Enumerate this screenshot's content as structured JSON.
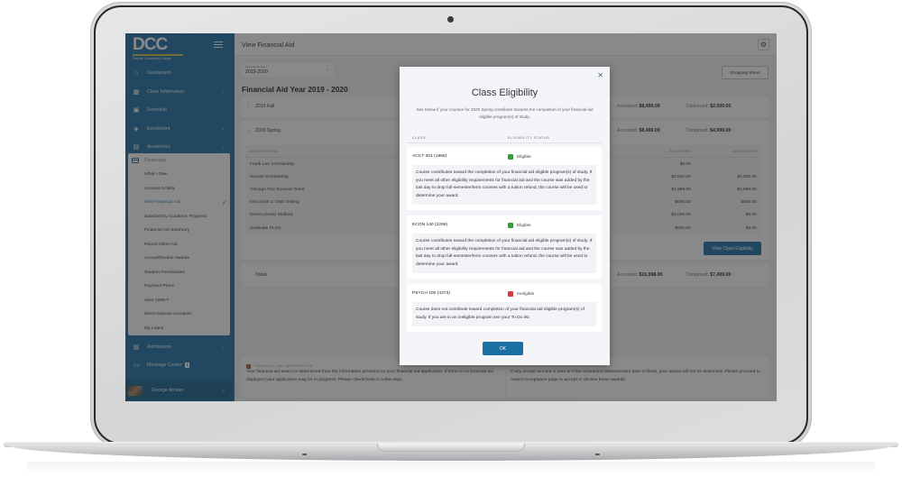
{
  "sidebar": {
    "logo_text": "DCC",
    "logo_subtitle": "Danville Community College",
    "items": [
      {
        "label": "Dashboard",
        "icon": "home-icon",
        "has_chevron": false
      },
      {
        "label": "Class Information",
        "icon": "grid-icon",
        "has_chevron": true
      },
      {
        "label": "Schedule",
        "icon": "calendar-icon",
        "has_chevron": false
      },
      {
        "label": "Enrollment",
        "icon": "graduation-cap-icon",
        "has_chevron": true
      },
      {
        "label": "Academics",
        "icon": "document-icon",
        "has_chevron": true
      }
    ],
    "financials": {
      "label": "Financials",
      "expanded": true,
      "sub_items": [
        {
          "label": "What I Owe"
        },
        {
          "label": "Account Activity"
        },
        {
          "label": "View Financial Aid",
          "active": true
        },
        {
          "label": "Satisfactory Academic Progress"
        },
        {
          "label": "Financial Aid Summary"
        },
        {
          "label": "Report Other Aid"
        },
        {
          "label": "Accept/Decline Awards"
        },
        {
          "label": "Student Permissions"
        },
        {
          "label": "Payment Plans"
        },
        {
          "label": "View 1098-T"
        },
        {
          "label": "Direct Deposit Accounts"
        },
        {
          "label": "My Loans"
        }
      ]
    },
    "bottom_items": [
      {
        "label": "Admissions",
        "icon": "id-card-icon",
        "has_chevron": true
      },
      {
        "label": "Message Center",
        "icon": "message-icon",
        "badge": "1"
      }
    ],
    "user": {
      "name": "George Amaier"
    }
  },
  "header": {
    "title": "View Financial Aid",
    "settings_icon": "gear-icon"
  },
  "aid_year_select": {
    "label": "Financial Aid Year",
    "required_mark": "*",
    "value": "2019-2020"
  },
  "shopping_sheet_label": "Shopping Sheet",
  "aid_year_title": "Financial Aid Year 2019 - 2020",
  "terms": [
    {
      "name": "2019 Fall",
      "expanded": false,
      "accepted_label": "Accepted:",
      "accepted": "$8,499.00",
      "disbursed_label": "Disbursed:",
      "disbursed": "$2,500.00"
    },
    {
      "name": "2020 Spring",
      "expanded": true,
      "accepted_label": "Accepted:",
      "accepted": "$8,499.00",
      "disbursed_label": "Disbursed:",
      "disbursed": "$4,999.00"
    }
  ],
  "awards_table": {
    "headers": {
      "description": "DESCRIPTION",
      "accepted": "ACCEPTED",
      "disbursed": "DISBURSED"
    },
    "rows": [
      {
        "description": "Frank Lee Scholarship",
        "accepted": "$0.00",
        "disbursed": "-"
      },
      {
        "description": "Honors Scholarship",
        "accepted": "$2,500.00",
        "disbursed": "$2,500.00"
      },
      {
        "description": "Chicago Fire Survivor Grant",
        "accepted": "$1,999.00",
        "disbursed": "$1,999.00"
      },
      {
        "description": "Inst Grant 1: Disb Testing",
        "accepted": "$500.00",
        "disbursed": "$500.00"
      },
      {
        "description": "Direct UnSub Stafford",
        "accepted": "$3,000.00",
        "disbursed": "$0.00"
      },
      {
        "description": "Graduate PLUS",
        "accepted": "$500.00",
        "disbursed": "$0.00"
      }
    ]
  },
  "view_class_eligibility_label": "View Class Eligibility",
  "totals": {
    "label": "Totals",
    "accepted_label": "Accepted:",
    "accepted": "$16,998.00",
    "disbursed_label": "Disbursed:",
    "disbursed": "$7,499.00"
  },
  "info": {
    "title": "FINANCIAL AID INFORMATION",
    "left_text": "Your financial aid award is determined from the information provided on your financial aid application. If there is no financial aid displayed your application may be in progress. Please check back in a few days.",
    "right_text": "If any accept amount is zero or if the scheduled disbursement date is blank, your award will not be disbursed. Please proceed to Award Acceptance page to accept or decline these awards."
  },
  "modal": {
    "title": "Class Eligibility",
    "subtitle": "See below if your courses for 2020 Spring contribute towards the completion of your financial aid eligible program(s) of study.",
    "col_class": "CLASS",
    "col_status": "ELIGIBILITY STATUS",
    "classes": [
      {
        "name": "ACCT 201 (1886)",
        "status": "Eligible",
        "status_color": "#3a9a3a",
        "description": "Course contributes toward the completion of your financial aid eligible program(s) of study. If you meet all other eligibility requirements for financial aid and the course was added by the last day to drop full-semester/term courses with a tuition refund, the course will be used to determine your award."
      },
      {
        "name": "ECON 140 (2259)",
        "status": "Eligible",
        "status_color": "#3a9a3a",
        "description": "Course contributes toward the completion of your financial aid eligible program(s) of study. If you meet all other eligibility requirements for financial aid and the course was added by the last day to drop full-semester/term courses with a tuition refund, the course will be used to determine your award."
      },
      {
        "name": "PSYCH 100 (4373)",
        "status": "Ineligible",
        "status_color": "#d63a3a",
        "description": "Course does not contribute toward completion of your financial aid eligible program(s) of study. If you are in an ineligible program see your To Do list."
      }
    ],
    "ok_label": "OK"
  },
  "colors": {
    "brand": "#1a6fa4",
    "eligible": "#3a9a3a",
    "ineligible": "#d63a3a"
  }
}
